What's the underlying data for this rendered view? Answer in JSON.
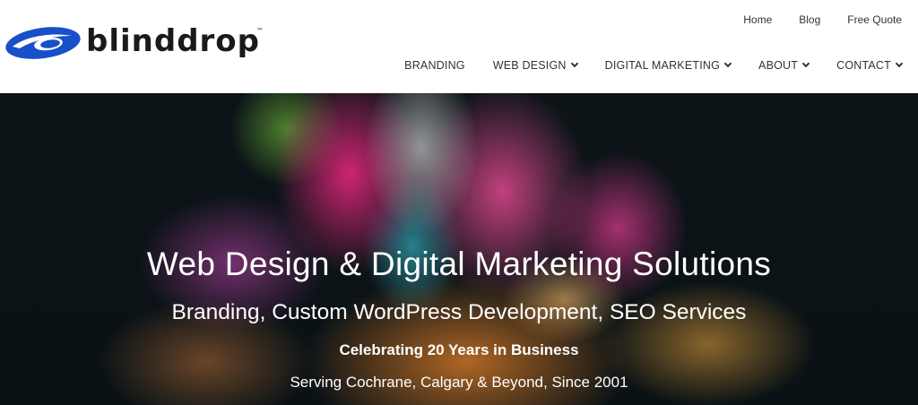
{
  "brand": {
    "name": "blinddrop",
    "trademark": "™",
    "logo_color": "#1750c8"
  },
  "top_nav": {
    "items": [
      {
        "label": "Home"
      },
      {
        "label": "Blog"
      },
      {
        "label": "Free Quote"
      }
    ]
  },
  "main_nav": {
    "items": [
      {
        "label": "BRANDING",
        "has_dropdown": false
      },
      {
        "label": "WEB DESIGN",
        "has_dropdown": true
      },
      {
        "label": "DIGITAL MARKETING",
        "has_dropdown": true
      },
      {
        "label": "ABOUT",
        "has_dropdown": true
      },
      {
        "label": "CONTACT",
        "has_dropdown": true
      }
    ]
  },
  "hero": {
    "headline": "Web Design & Digital Marketing Solutions",
    "subheadline": "Branding, Custom WordPress Development, SEO Services",
    "tagline": "Celebrating 20 Years in Business",
    "location_line": "Serving Cochrane, Calgary & Beyond, Since 2001"
  }
}
